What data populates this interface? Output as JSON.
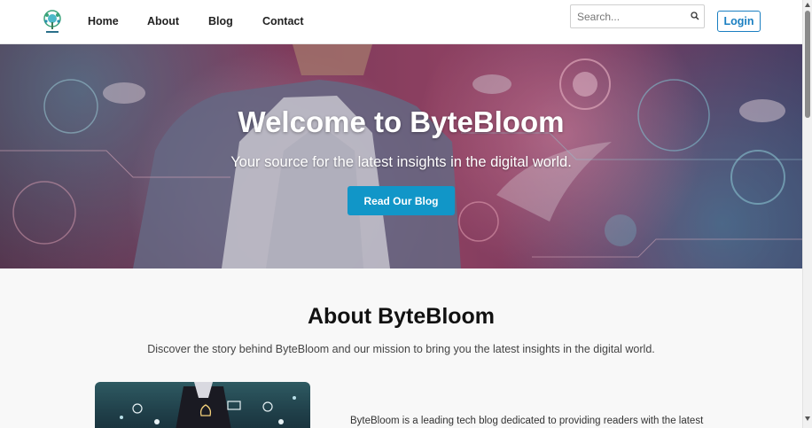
{
  "header": {
    "logo_icon": "bytebloom-tree-logo-icon",
    "nav": [
      {
        "label": "Home"
      },
      {
        "label": "About"
      },
      {
        "label": "Blog"
      },
      {
        "label": "Contact"
      }
    ],
    "search": {
      "placeholder": "Search...",
      "value": "",
      "icon": "search-icon"
    },
    "login_label": "Login"
  },
  "hero": {
    "title": "Welcome to ByteBloom",
    "subtitle": "Your source for the latest insights in the digital world.",
    "button_label": "Read Our Blog"
  },
  "about": {
    "title": "About ByteBloom",
    "description": "Discover the story behind ByteBloom and our mission to bring you the latest insights in the digital world.",
    "body_text": "ByteBloom is a leading tech blog dedicated to providing readers with the latest"
  },
  "colors": {
    "accent": "#1196c8",
    "login_border": "#1a7fc1",
    "page_background": "#f8f8f8"
  }
}
